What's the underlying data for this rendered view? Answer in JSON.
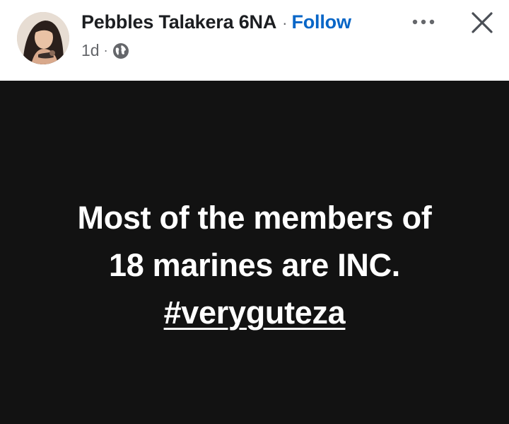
{
  "post": {
    "author_name": "Pebbles Talakera 6NA",
    "separator": "·",
    "follow_label": "Follow",
    "timestamp": "1d",
    "meta_separator": "·",
    "audience_icon": "globe-icon",
    "more_icon": "more-options-icon",
    "close_icon": "close-icon",
    "body_lines": [
      "Most of the members of",
      "18 marines are INC."
    ],
    "hashtag": "#veryguteza",
    "background_color": "#121212",
    "text_color": "#ffffff",
    "link_color": "#0866c7"
  }
}
